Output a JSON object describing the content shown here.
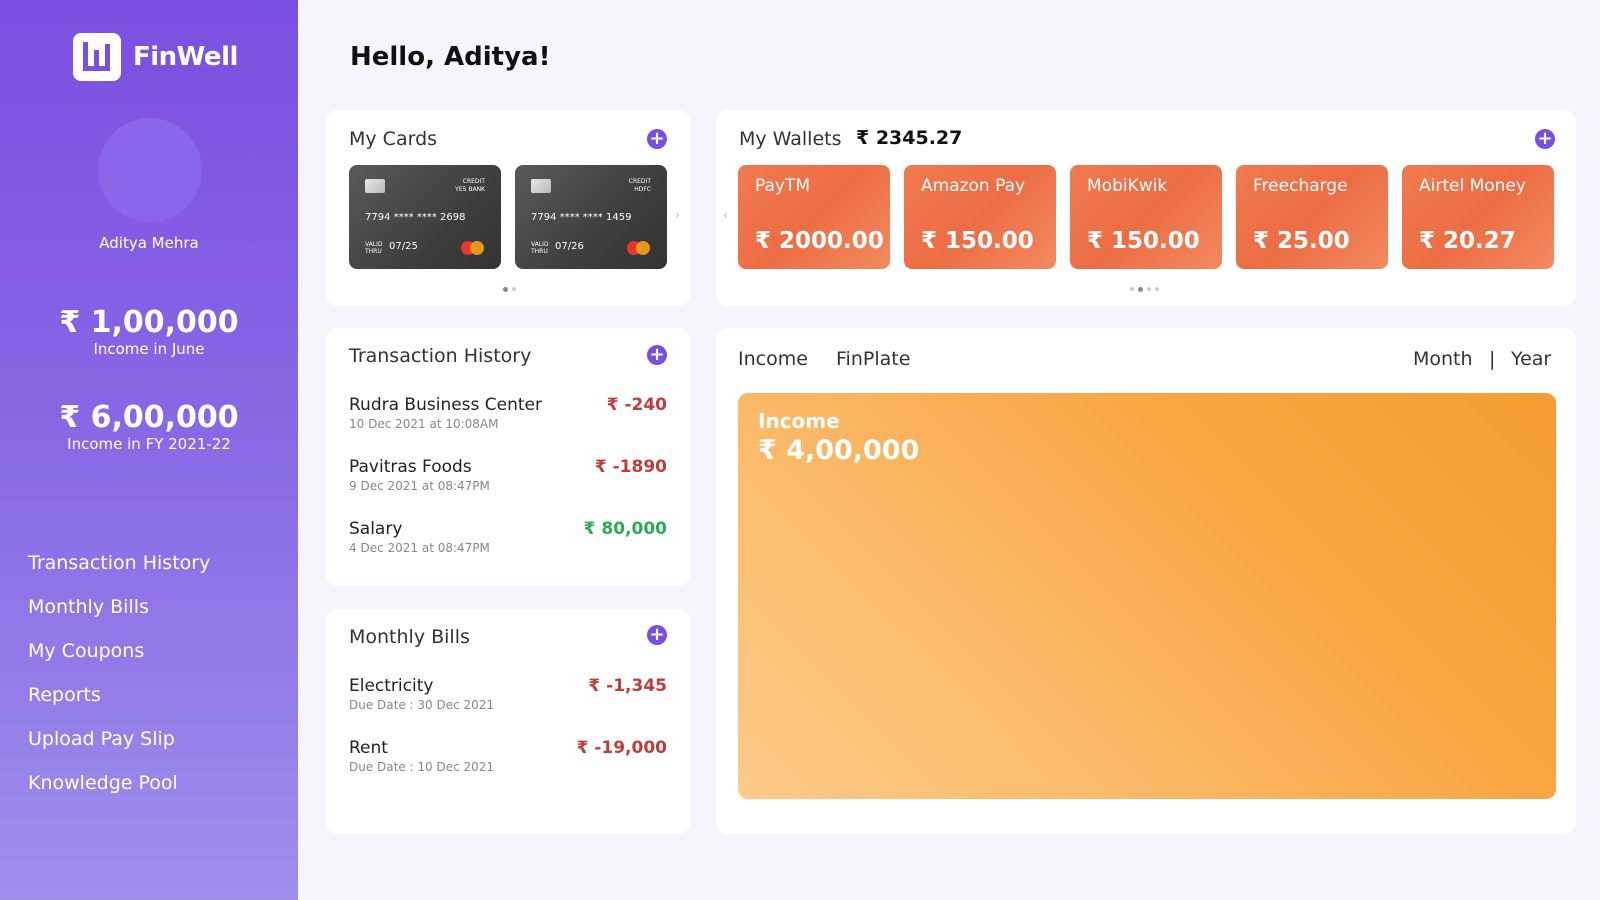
{
  "app": {
    "name": "FinWell"
  },
  "user": {
    "name": "Aditya Mehra",
    "greeting": "Hello, Aditya!"
  },
  "stats": [
    {
      "amount": "₹ 1,00,000",
      "label": "Income in June"
    },
    {
      "amount": "₹ 6,00,000",
      "label": "Income in FY 2021-22"
    }
  ],
  "nav": [
    {
      "label": "Transaction History"
    },
    {
      "label": "Monthly Bills"
    },
    {
      "label": "My Coupons"
    },
    {
      "label": "Reports"
    },
    {
      "label": "Upload Pay Slip"
    },
    {
      "label": "Knowledge Pool"
    }
  ],
  "cards": {
    "title": "My Cards",
    "plus": "+",
    "next": "›",
    "items": [
      {
        "type": "CREDIT",
        "bank": "YES BANK",
        "number": "7794 **** **** 2698",
        "valid_label_1": "VALID",
        "valid_label_2": "THRU",
        "valid": "07/25"
      },
      {
        "type": "CREDIT",
        "bank": "HDFC",
        "number": "7794 **** **** 1459",
        "valid_label_1": "VALID",
        "valid_label_2": "THRU",
        "valid": "07/26"
      }
    ]
  },
  "wallets": {
    "title": "My Wallets",
    "balance": "₹ 2345.27",
    "plus": "+",
    "prev": "‹",
    "items": [
      {
        "name": "PayTM",
        "amount": "₹ 2000.00"
      },
      {
        "name": "Amazon Pay",
        "amount": "₹ 150.00"
      },
      {
        "name": "MobiKwik",
        "amount": "₹ 150.00"
      },
      {
        "name": "Freecharge",
        "amount": "₹ 25.00"
      },
      {
        "name": "Airtel Money",
        "amount": "₹ 20.27"
      }
    ]
  },
  "transactions": {
    "title": "Transaction History",
    "plus": "+",
    "items": [
      {
        "name": "Rudra Business Center",
        "date": "10 Dec 2021 at 10:08AM",
        "amount": "₹ -240",
        "kind": "neg"
      },
      {
        "name": "Pavitras Foods",
        "date": "9 Dec 2021 at 08:47PM",
        "amount": "₹ -1890",
        "kind": "neg"
      },
      {
        "name": "Salary",
        "date": "4 Dec 2021 at 08:47PM",
        "amount": "₹ 80,000",
        "kind": "pos"
      }
    ]
  },
  "bills": {
    "title": "Monthly Bills",
    "plus": "+",
    "items": [
      {
        "name": "Electricity",
        "due": "Due Date : 30 Dec 2021",
        "amount": "₹ -1,345"
      },
      {
        "name": "Rent",
        "due": "Due Date : 10 Dec 2021",
        "amount": "₹ -19,000"
      }
    ]
  },
  "income": {
    "tabs": {
      "income": "Income",
      "finplate": "FinPlate",
      "month": "Month",
      "separator": "|",
      "year": "Year"
    },
    "box_label": "Income",
    "box_amount": "₹ 4,00,000"
  },
  "colors": {
    "accent": "#7a4fe0",
    "wallet": "#ec6d45",
    "income": "#f7a13c",
    "negative": "#c23b3b",
    "positive": "#2eaa55"
  },
  "icons": {
    "logo": "bar-chart-logo-icon",
    "add": "plus-circle-icon"
  }
}
